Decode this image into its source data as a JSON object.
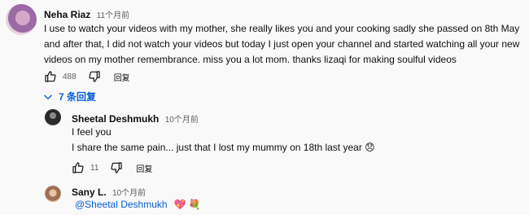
{
  "comment": {
    "author": "Neha Riaz",
    "time": "11个月前",
    "text_lines": [
      "I use to watch your videos with my mother, she really likes you and your cooking sadly she passed on 8th May",
      "and after that, I did not watch your videos but today I just open your channel and started watching all your new",
      "videos on my mother remembrance. miss you a lot mom. thanks lizaqi for making soulful videos"
    ],
    "likes": "488",
    "reply_label": "回复",
    "replies_toggle": "7 条回复"
  },
  "replies": [
    {
      "author": "Sheetal Deshmukh",
      "time": "10个月前",
      "text_lines": [
        "I feel you",
        "I share the same pain... just that I lost my mummy on 18th last year 😞"
      ],
      "likes": "11",
      "reply_label": "回复"
    },
    {
      "author": "Sany L.",
      "time": "10个月前",
      "mention": "@Sheetal Deshmukh",
      "emoji_1": "💖",
      "emoji_2": "💐"
    }
  ],
  "icons": {
    "like": "thumb-up-icon",
    "dislike": "thumb-down-icon",
    "toggle": "chevron-down-icon"
  },
  "colors": {
    "link": "#065fd4",
    "meta": "#606060",
    "background": "#f9f9f9"
  }
}
